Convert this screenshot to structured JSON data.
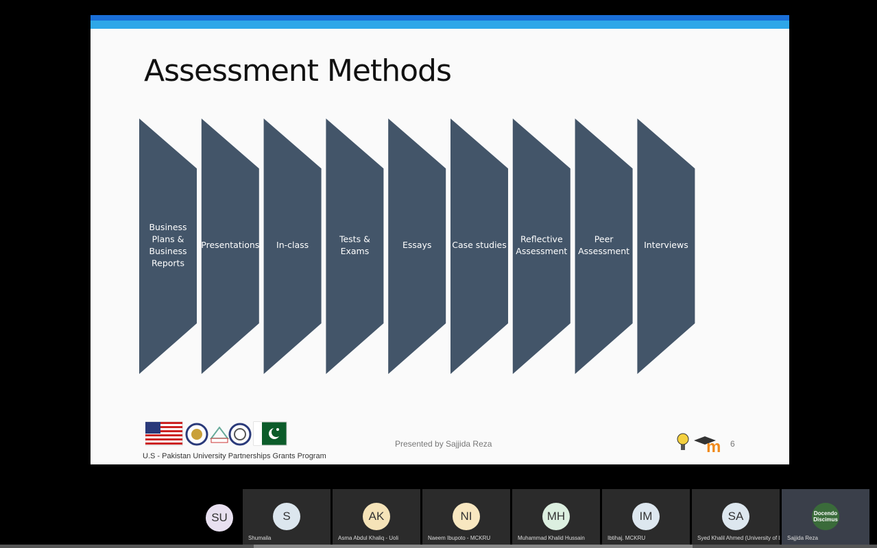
{
  "slide": {
    "title": "Assessment Methods",
    "presenter": "Presented by Sajjida Reza",
    "page_number": "6",
    "program": "U.S - Pakistan University Partnerships Grants Program",
    "logo_text": "m",
    "methods": [
      [
        "Business",
        "Plans &",
        "Business",
        "Reports"
      ],
      [
        "Presentations"
      ],
      [
        "In-class"
      ],
      [
        "Tests &",
        "Exams"
      ],
      [
        "Essays"
      ],
      [
        "Case studies"
      ],
      [
        "Reflective",
        "Assessment"
      ],
      [
        "Peer",
        "Assessment"
      ],
      [
        "Interviews"
      ]
    ],
    "colors": {
      "chevron": "#435569",
      "top_bar": "#1a6fd8",
      "top_bar_light": "#2ea7e8"
    }
  },
  "participants": [
    {
      "initials": "SU",
      "name": "",
      "color": "#e8e0f0"
    },
    {
      "initials": "S",
      "name": "Shumaila",
      "color": "#dce6ee"
    },
    {
      "initials": "AK",
      "name": "Asma Abdul Khaliq - Uoli",
      "color": "#f5e3b8"
    },
    {
      "initials": "NI",
      "name": "Naeem Ibupoto - MCKRU",
      "color": "#f8e7c0"
    },
    {
      "initials": "MH",
      "name": "Muhammad Khalid Hussain",
      "color": "#dcefe0"
    },
    {
      "initials": "IM",
      "name": "Ibtihaj. MCKRU",
      "color": "#dde7ef"
    },
    {
      "initials": "SA",
      "name": "Syed Khalil Ahmed (University of Lo...",
      "color": "#dde7ef"
    },
    {
      "initials": "",
      "name": "Sajjida Reza",
      "avatar_text": "Docendo Discimus",
      "color": "#3a6b3a"
    }
  ]
}
